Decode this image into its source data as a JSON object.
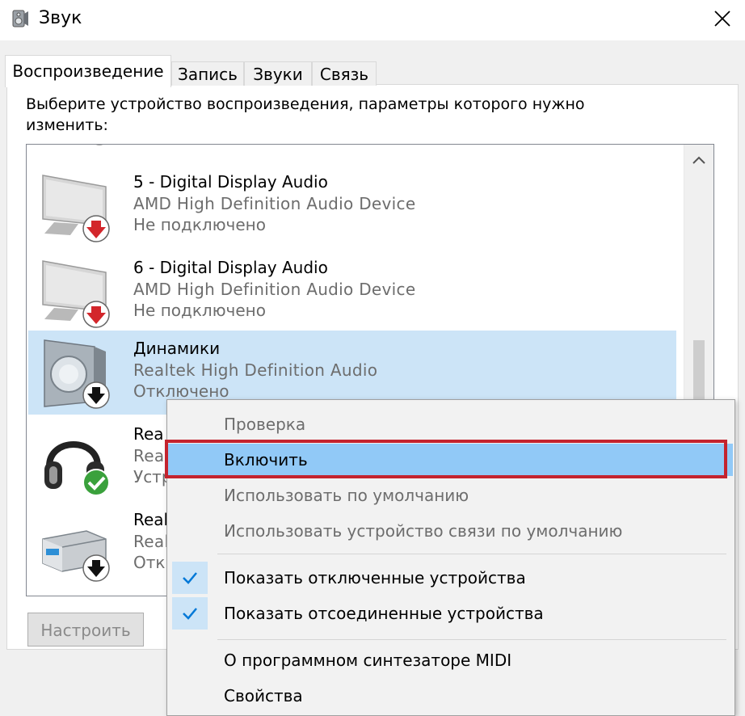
{
  "window": {
    "title": "Звук",
    "close_icon": "close-icon",
    "title_icon": "speaker-icon"
  },
  "tabs": [
    {
      "label": "Воспроизведение",
      "active": true
    },
    {
      "label": "Запись",
      "active": false
    },
    {
      "label": "Звуки",
      "active": false
    },
    {
      "label": "Связь",
      "active": false
    }
  ],
  "instruction": "Выберите устройство воспроизведения, параметры которого нужно изменить:",
  "devices": [
    {
      "name": "5 - Digital Display Audio",
      "sub": "AMD High Definition Audio Device",
      "status": "Не подключено",
      "icon": "monitor-icon",
      "badge": "red-arrow-down-icon"
    },
    {
      "name": "6 - Digital Display Audio",
      "sub": "AMD High Definition Audio Device",
      "status": "Не подключено",
      "icon": "monitor-icon",
      "badge": "red-arrow-down-icon"
    },
    {
      "name": "Динамики",
      "sub": "Realtek High Definition Audio",
      "status": "Отключено",
      "icon": "speaker-icon",
      "badge": "black-arrow-down-icon",
      "selected": true
    },
    {
      "name": "Rea",
      "sub": "Rea",
      "status": "Устр",
      "icon": "headphones-icon",
      "badge": "green-check-icon"
    },
    {
      "name": "Real",
      "sub": "Real",
      "status": "Отк",
      "icon": "receiver-icon",
      "badge": "black-arrow-down-icon"
    }
  ],
  "buttons": {
    "configure": "Настроить"
  },
  "context_menu": {
    "items": [
      {
        "label": "Проверка",
        "state": "disabled"
      },
      {
        "label": "Включить",
        "state": "highlighted"
      },
      {
        "label": "Использовать по умолчанию",
        "state": "disabled"
      },
      {
        "label": "Использовать устройство связи по умолчанию",
        "state": "disabled"
      },
      {
        "label": "Показать отключенные устройства",
        "state": "checked"
      },
      {
        "label": "Показать отсоединенные устройства",
        "state": "checked"
      },
      {
        "label": "О программном синтезаторе MIDI",
        "state": "normal"
      },
      {
        "label": "Свойства",
        "state": "normal"
      }
    ]
  },
  "colors": {
    "selection": "#cce4f7",
    "menu_highlight": "#91c9f7",
    "annotation_frame": "#c4232e",
    "check": "#0078d7"
  }
}
